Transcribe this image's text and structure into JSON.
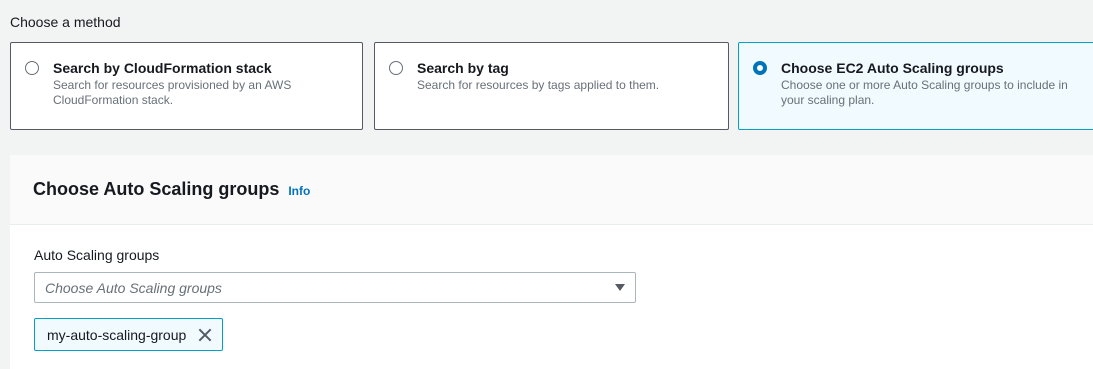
{
  "method": {
    "label": "Choose a method",
    "options": [
      {
        "title": "Search by CloudFormation stack",
        "description": "Search for resources provisioned by an AWS CloudFormation stack.",
        "selected": false
      },
      {
        "title": "Search by tag",
        "description": "Search for resources by tags applied to them.",
        "selected": false
      },
      {
        "title": "Choose EC2 Auto Scaling groups",
        "description": "Choose one or more Auto Scaling groups to include in your scaling plan.",
        "selected": true
      }
    ]
  },
  "panel": {
    "title": "Choose Auto Scaling groups",
    "info_link": "Info",
    "field_label": "Auto Scaling groups",
    "select_placeholder": "Choose Auto Scaling groups",
    "tokens": [
      {
        "label": "my-auto-scaling-group"
      }
    ]
  },
  "colors": {
    "accent": "#0073bb",
    "selected_border": "#00a1c9",
    "selected_bg": "#f1faff"
  },
  "icons": {
    "select_caret": "caret-down-icon",
    "token_dismiss": "close-icon"
  }
}
